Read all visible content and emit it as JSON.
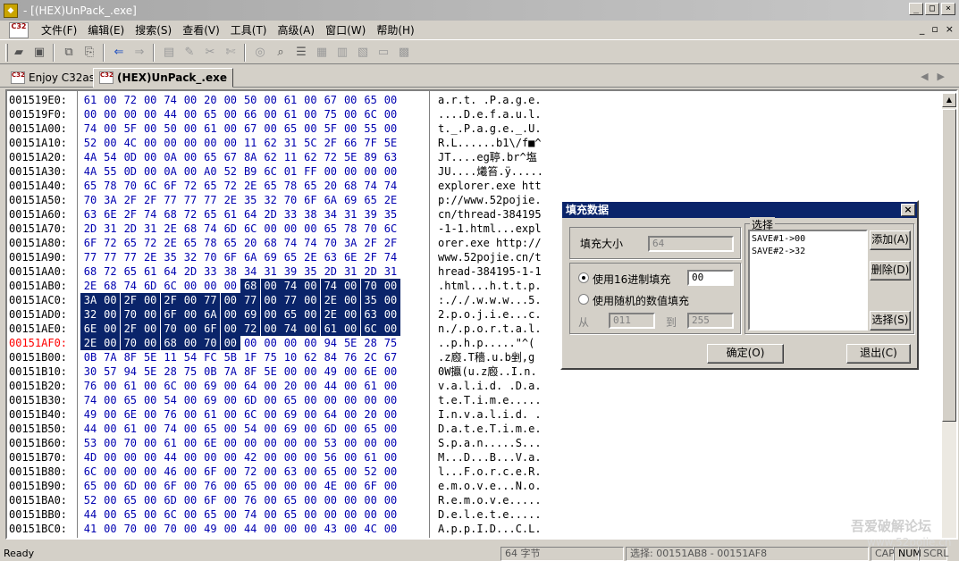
{
  "window": {
    "title": "- [(HEX)UnPack_.exe]",
    "min": "_",
    "max": "□",
    "close": "×"
  },
  "menu": {
    "items": [
      "文件(F)",
      "编辑(E)",
      "搜索(S)",
      "查看(V)",
      "工具(T)",
      "高级(A)",
      "窗口(W)",
      "帮助(H)"
    ],
    "mdi": [
      "_",
      "▫",
      "×"
    ],
    "logo": "C32"
  },
  "toolbar": {
    "buttons": [
      "open-folder-icon",
      "save-icon",
      "copy-icon",
      "paste-icon",
      "back-arrow-icon",
      "forward-arrow-icon",
      "page-icon",
      "edit-icon",
      "tool-icon",
      "tool2-icon",
      "disk-icon",
      "find-icon",
      "align-icon",
      "grid-icon",
      "grid2-icon",
      "grid3-icon",
      "minus-icon",
      "table-icon"
    ]
  },
  "tabs": [
    {
      "label": "Enjoy C32asm",
      "active": false
    },
    {
      "label": "(HEX)UnPack_.exe",
      "active": true
    }
  ],
  "hex": {
    "rows": [
      {
        "addr": "001519E0:",
        "bytes": [
          "61",
          "00",
          "72",
          "00",
          "74",
          "00",
          "20",
          "00",
          "50",
          "00",
          "61",
          "00",
          "67",
          "00",
          "65",
          "00"
        ],
        "ascii": "a.r.t. .P.a.g.e."
      },
      {
        "addr": "001519F0:",
        "bytes": [
          "00",
          "00",
          "00",
          "00",
          "44",
          "00",
          "65",
          "00",
          "66",
          "00",
          "61",
          "00",
          "75",
          "00",
          "6C",
          "00"
        ],
        "ascii": "....D.e.f.a.u.l."
      },
      {
        "addr": "00151A00:",
        "bytes": [
          "74",
          "00",
          "5F",
          "00",
          "50",
          "00",
          "61",
          "00",
          "67",
          "00",
          "65",
          "00",
          "5F",
          "00",
          "55",
          "00"
        ],
        "ascii": "t._.P.a.g.e._.U."
      },
      {
        "addr": "00151A10:",
        "bytes": [
          "52",
          "00",
          "4C",
          "00",
          "00",
          "00",
          "00",
          "00",
          "11",
          "62",
          "31",
          "5C",
          "2F",
          "66",
          "7F",
          "5E"
        ],
        "ascii": "R.L......b1\\/f■^"
      },
      {
        "addr": "00151A20:",
        "bytes": [
          "4A",
          "54",
          "0D",
          "00",
          "0A",
          "00",
          "65",
          "67",
          "8A",
          "62",
          "11",
          "62",
          "72",
          "5E",
          "89",
          "63"
        ],
        "ascii": "JT....eg聤.br^塩"
      },
      {
        "addr": "00151A30:",
        "bytes": [
          "4A",
          "55",
          "0D",
          "00",
          "0A",
          "00",
          "A0",
          "52",
          "B9",
          "6C",
          "01",
          "FF",
          "00",
          "00",
          "00",
          "00"
        ],
        "ascii": "JU....爔笞.ÿ....."
      },
      {
        "addr": "00151A40:",
        "bytes": [
          "65",
          "78",
          "70",
          "6C",
          "6F",
          "72",
          "65",
          "72",
          "2E",
          "65",
          "78",
          "65",
          "20",
          "68",
          "74",
          "74"
        ],
        "ascii": "explorer.exe htt"
      },
      {
        "addr": "00151A50:",
        "bytes": [
          "70",
          "3A",
          "2F",
          "2F",
          "77",
          "77",
          "77",
          "2E",
          "35",
          "32",
          "70",
          "6F",
          "6A",
          "69",
          "65",
          "2E"
        ],
        "ascii": "p://www.52pojie."
      },
      {
        "addr": "00151A60:",
        "bytes": [
          "63",
          "6E",
          "2F",
          "74",
          "68",
          "72",
          "65",
          "61",
          "64",
          "2D",
          "33",
          "38",
          "34",
          "31",
          "39",
          "35"
        ],
        "ascii": "cn/thread-384195"
      },
      {
        "addr": "00151A70:",
        "bytes": [
          "2D",
          "31",
          "2D",
          "31",
          "2E",
          "68",
          "74",
          "6D",
          "6C",
          "00",
          "00",
          "00",
          "65",
          "78",
          "70",
          "6C"
        ],
        "ascii": "-1-1.html...expl"
      },
      {
        "addr": "00151A80:",
        "bytes": [
          "6F",
          "72",
          "65",
          "72",
          "2E",
          "65",
          "78",
          "65",
          "20",
          "68",
          "74",
          "74",
          "70",
          "3A",
          "2F",
          "2F"
        ],
        "ascii": "orer.exe http://"
      },
      {
        "addr": "00151A90:",
        "bytes": [
          "77",
          "77",
          "77",
          "2E",
          "35",
          "32",
          "70",
          "6F",
          "6A",
          "69",
          "65",
          "2E",
          "63",
          "6E",
          "2F",
          "74"
        ],
        "ascii": "www.52pojie.cn/t"
      },
      {
        "addr": "00151AA0:",
        "bytes": [
          "68",
          "72",
          "65",
          "61",
          "64",
          "2D",
          "33",
          "38",
          "34",
          "31",
          "39",
          "35",
          "2D",
          "31",
          "2D",
          "31"
        ],
        "ascii": "hread-384195-1-1"
      },
      {
        "addr": "00151AB0:",
        "bytes": [
          "2E",
          "68",
          "74",
          "6D",
          "6C",
          "00",
          "00",
          "00",
          "68",
          "00",
          "74",
          "00",
          "74",
          "00",
          "70",
          "00"
        ],
        "ascii": ".html...h.t.t.p.",
        "sel_from": 8
      },
      {
        "addr": "00151AC0:",
        "bytes": [
          "3A",
          "00",
          "2F",
          "00",
          "2F",
          "00",
          "77",
          "00",
          "77",
          "00",
          "77",
          "00",
          "2E",
          "00",
          "35",
          "00"
        ],
        "ascii": ":././.w.w.w...5.",
        "sel_from": 0
      },
      {
        "addr": "00151AD0:",
        "bytes": [
          "32",
          "00",
          "70",
          "00",
          "6F",
          "00",
          "6A",
          "00",
          "69",
          "00",
          "65",
          "00",
          "2E",
          "00",
          "63",
          "00"
        ],
        "ascii": "2.p.o.j.i.e...c.",
        "sel_from": 0
      },
      {
        "addr": "00151AE0:",
        "bytes": [
          "6E",
          "00",
          "2F",
          "00",
          "70",
          "00",
          "6F",
          "00",
          "72",
          "00",
          "74",
          "00",
          "61",
          "00",
          "6C",
          "00"
        ],
        "ascii": "n./.p.o.r.t.a.l.",
        "sel_from": 0
      },
      {
        "addr": "00151AF0:",
        "bytes": [
          "2E",
          "00",
          "70",
          "00",
          "68",
          "00",
          "70",
          "00",
          "00",
          "00",
          "00",
          "00",
          "94",
          "5E",
          "28",
          "75"
        ],
        "ascii": "..p.h.p.....\"^(",
        "sel_from": 0,
        "sel_to": 8,
        "current": true
      },
      {
        "addr": "00151B00:",
        "bytes": [
          "0B",
          "7A",
          "8F",
          "5E",
          "11",
          "54",
          "FC",
          "5B",
          "1F",
          "75",
          "10",
          "62",
          "84",
          "76",
          "2C",
          "67"
        ],
        "ascii": ".z廏.T穡.u.b剉,g"
      },
      {
        "addr": "00151B10:",
        "bytes": [
          "30",
          "57",
          "94",
          "5E",
          "28",
          "75",
          "0B",
          "7A",
          "8F",
          "5E",
          "00",
          "00",
          "49",
          "00",
          "6E",
          "00"
        ],
        "ascii": "0W攍(u.z廏..I.n."
      },
      {
        "addr": "00151B20:",
        "bytes": [
          "76",
          "00",
          "61",
          "00",
          "6C",
          "00",
          "69",
          "00",
          "64",
          "00",
          "20",
          "00",
          "44",
          "00",
          "61",
          "00"
        ],
        "ascii": "v.a.l.i.d. .D.a."
      },
      {
        "addr": "00151B30:",
        "bytes": [
          "74",
          "00",
          "65",
          "00",
          "54",
          "00",
          "69",
          "00",
          "6D",
          "00",
          "65",
          "00",
          "00",
          "00",
          "00",
          "00"
        ],
        "ascii": "t.e.T.i.m.e....."
      },
      {
        "addr": "00151B40:",
        "bytes": [
          "49",
          "00",
          "6E",
          "00",
          "76",
          "00",
          "61",
          "00",
          "6C",
          "00",
          "69",
          "00",
          "64",
          "00",
          "20",
          "00"
        ],
        "ascii": "I.n.v.a.l.i.d. ."
      },
      {
        "addr": "00151B50:",
        "bytes": [
          "44",
          "00",
          "61",
          "00",
          "74",
          "00",
          "65",
          "00",
          "54",
          "00",
          "69",
          "00",
          "6D",
          "00",
          "65",
          "00"
        ],
        "ascii": "D.a.t.e.T.i.m.e."
      },
      {
        "addr": "00151B60:",
        "bytes": [
          "53",
          "00",
          "70",
          "00",
          "61",
          "00",
          "6E",
          "00",
          "00",
          "00",
          "00",
          "00",
          "53",
          "00",
          "00",
          "00"
        ],
        "ascii": "S.p.a.n.....S..."
      },
      {
        "addr": "00151B70:",
        "bytes": [
          "4D",
          "00",
          "00",
          "00",
          "44",
          "00",
          "00",
          "00",
          "42",
          "00",
          "00",
          "00",
          "56",
          "00",
          "61",
          "00"
        ],
        "ascii": "M...D...B...V.a."
      },
      {
        "addr": "00151B80:",
        "bytes": [
          "6C",
          "00",
          "00",
          "00",
          "46",
          "00",
          "6F",
          "00",
          "72",
          "00",
          "63",
          "00",
          "65",
          "00",
          "52",
          "00"
        ],
        "ascii": "l...F.o.r.c.e.R."
      },
      {
        "addr": "00151B90:",
        "bytes": [
          "65",
          "00",
          "6D",
          "00",
          "6F",
          "00",
          "76",
          "00",
          "65",
          "00",
          "00",
          "00",
          "4E",
          "00",
          "6F",
          "00"
        ],
        "ascii": "e.m.o.v.e...N.o."
      },
      {
        "addr": "00151BA0:",
        "bytes": [
          "52",
          "00",
          "65",
          "00",
          "6D",
          "00",
          "6F",
          "00",
          "76",
          "00",
          "65",
          "00",
          "00",
          "00",
          "00",
          "00"
        ],
        "ascii": "R.e.m.o.v.e....."
      },
      {
        "addr": "00151BB0:",
        "bytes": [
          "44",
          "00",
          "65",
          "00",
          "6C",
          "00",
          "65",
          "00",
          "74",
          "00",
          "65",
          "00",
          "00",
          "00",
          "00",
          "00"
        ],
        "ascii": "D.e.l.e.t.e....."
      },
      {
        "addr": "00151BC0:",
        "bytes": [
          "41",
          "00",
          "70",
          "00",
          "70",
          "00",
          "49",
          "00",
          "44",
          "00",
          "00",
          "00",
          "43",
          "00",
          "4C",
          "00"
        ],
        "ascii": "A.p.p.I.D...C.L."
      }
    ]
  },
  "dialog": {
    "title": "填充数据",
    "close": "×",
    "fill_size_label": "填充大小",
    "fill_size_value": "64",
    "hex_fill_label": "使用16进制填充",
    "hex_fill_value": "00",
    "random_fill_label": "使用随机的数值填充",
    "from_label": "从",
    "from_value": "011",
    "to_label": "到",
    "to_value": "255",
    "select_group": "选择",
    "list": [
      "SAVE#1->00",
      "SAVE#2->32"
    ],
    "add_btn": "添加(A)",
    "delete_btn": "删除(D)",
    "select_btn": "选择(S)",
    "ok_btn": "确定(O)",
    "exit_btn": "退出(C)"
  },
  "status": {
    "ready": "Ready",
    "bytes": "64 字节",
    "selection": "选择: 00151AB8 - 00151AF8",
    "caps": "CAP",
    "num": "NUM",
    "scrl": "SCRL"
  },
  "watermark": {
    "line1": "吾爱破解论坛",
    "line2": "www.52pojie.cn"
  }
}
